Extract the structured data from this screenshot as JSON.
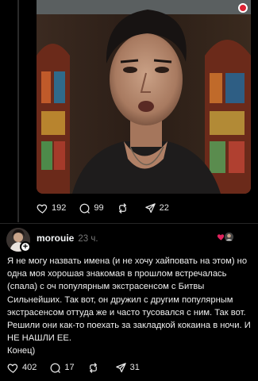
{
  "top_post": {
    "likes": "192",
    "comments": "99",
    "shares": "22"
  },
  "post": {
    "username": "morouie",
    "timestamp": "23 ч.",
    "text": "Я не могу назвать имена (и не хочу хайповать на этом) но одна моя хорошая знакомая в прошлом встречалась (спала) с оч популярным экстрасенсом с Битвы Сильнейших. Так вот, он дружил с другим популярным экстрасенсом оттуда же и часто тусовался с ним. Так вот. Решили они как-то поехать за закладкой кокаина в ночи. И НЕ НАШЛИ ЕЕ.",
    "ending": "Конец)",
    "likes": "402",
    "comments": "17",
    "shares": "31"
  },
  "icons": {
    "like": "heart-icon",
    "comment": "comment-bubble-icon",
    "repost": "repost-icon",
    "share": "send-icon",
    "follow": "plus-icon"
  },
  "colors": {
    "background": "#000000",
    "text": "#f3f5f7",
    "muted": "#777777",
    "accent_red": "#e0245e"
  }
}
